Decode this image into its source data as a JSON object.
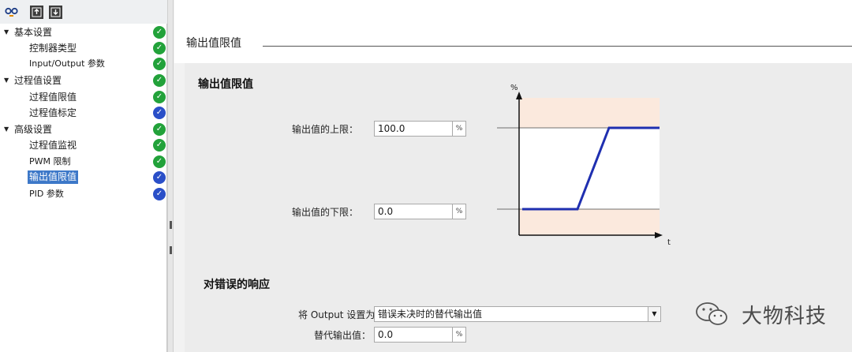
{
  "toolbar": {
    "icons": [
      "glasses-icon",
      "export-icon",
      "import-icon"
    ]
  },
  "tree": {
    "items": [
      {
        "label": "基本设置",
        "level": 0,
        "expanded": true,
        "status": "green"
      },
      {
        "label": "控制器类型",
        "level": 1,
        "status": "green"
      },
      {
        "label": "Input/Output 参数",
        "level": 1,
        "status": "green"
      },
      {
        "label": "过程值设置",
        "level": 0,
        "expanded": true,
        "status": "green"
      },
      {
        "label": "过程值限值",
        "level": 1,
        "status": "green"
      },
      {
        "label": "过程值标定",
        "level": 1,
        "status": "blue"
      },
      {
        "label": "高级设置",
        "level": 0,
        "expanded": true,
        "status": "green"
      },
      {
        "label": "过程值监视",
        "level": 1,
        "status": "green"
      },
      {
        "label": "PWM 限制",
        "level": 1,
        "status": "green"
      },
      {
        "label": "输出值限值",
        "level": 1,
        "status": "blue",
        "selected": true
      },
      {
        "label": "PID 参数",
        "level": 1,
        "status": "blue"
      }
    ]
  },
  "main": {
    "section_title": "输出值限值",
    "group_title": "输出值限值",
    "upper_limit": {
      "label": "输出值的上限：",
      "value": "100.0",
      "unit": "%"
    },
    "lower_limit": {
      "label": "输出值的下限：",
      "value": "0.0",
      "unit": "%"
    },
    "chart": {
      "y_axis_label": "%",
      "x_axis_label": "t"
    },
    "error_group_title": "对错误的响应",
    "set_output": {
      "label": "将 Output 设置为：",
      "value": "错误未决时的替代输出值"
    },
    "substitute_output": {
      "label": "替代输出值：",
      "value": "0.0",
      "unit": "%"
    }
  },
  "watermark": {
    "text": "大物科技"
  },
  "colors": {
    "selected": "#3d78c8",
    "status_green": "#22a23a",
    "status_blue": "#2a4fc8",
    "chart_band": "#fbe9dd",
    "chart_line": "#1f2fb0"
  }
}
